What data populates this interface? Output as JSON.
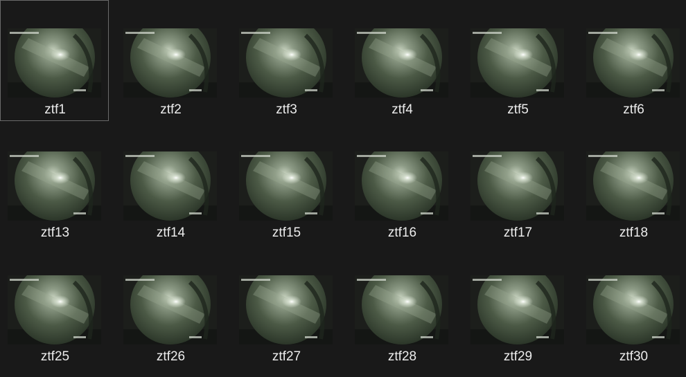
{
  "files": [
    {
      "name": "ztf1",
      "selected": true
    },
    {
      "name": "ztf2",
      "selected": false
    },
    {
      "name": "ztf3",
      "selected": false
    },
    {
      "name": "ztf4",
      "selected": false
    },
    {
      "name": "ztf5",
      "selected": false
    },
    {
      "name": "ztf6",
      "selected": false
    },
    {
      "name": "ztf13",
      "selected": false
    },
    {
      "name": "ztf14",
      "selected": false
    },
    {
      "name": "ztf15",
      "selected": false
    },
    {
      "name": "ztf16",
      "selected": false
    },
    {
      "name": "ztf17",
      "selected": false
    },
    {
      "name": "ztf18",
      "selected": false
    },
    {
      "name": "ztf25",
      "selected": false
    },
    {
      "name": "ztf26",
      "selected": false
    },
    {
      "name": "ztf27",
      "selected": false
    },
    {
      "name": "ztf28",
      "selected": false
    },
    {
      "name": "ztf29",
      "selected": false
    },
    {
      "name": "ztf30",
      "selected": false
    }
  ]
}
